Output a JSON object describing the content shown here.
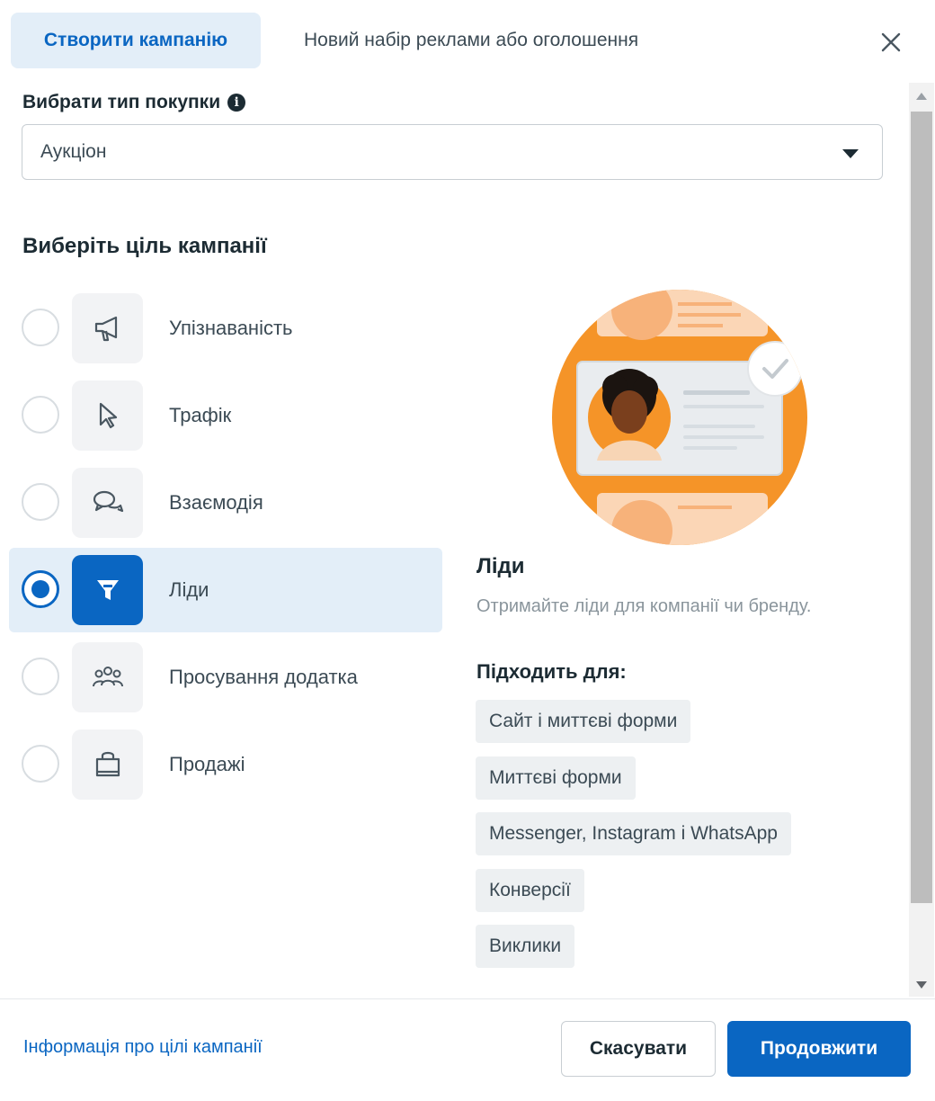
{
  "header": {
    "tab_create": "Створити кампанію",
    "tab_new": "Новий набір реклами або оголошення",
    "close_icon": "close-icon"
  },
  "purchase": {
    "label": "Вибрати тип покупки",
    "info_icon": "info-icon",
    "selected": "Аукціон"
  },
  "goal_title": "Виберіть ціль кампанії",
  "objectives": [
    {
      "label": "Упізнаваність",
      "icon": "megaphone-icon",
      "selected": false
    },
    {
      "label": "Трафік",
      "icon": "cursor-icon",
      "selected": false
    },
    {
      "label": "Взаємодія",
      "icon": "chat-bubbles-icon",
      "selected": false
    },
    {
      "label": "Ліди",
      "icon": "funnel-icon",
      "selected": true
    },
    {
      "label": "Просування додатка",
      "icon": "people-icon",
      "selected": false
    },
    {
      "label": "Продажі",
      "icon": "shopping-bag-icon",
      "selected": false
    }
  ],
  "detail": {
    "title": "Ліди",
    "description": "Отримайте ліди для компанії чи бренду.",
    "fits_label": "Підходить для:",
    "chips": [
      "Сайт і миттєві форми",
      "Миттєві форми",
      "Messenger, Instagram і WhatsApp",
      "Конверсії",
      "Виклики"
    ]
  },
  "footer": {
    "info_link": "Інформація про цілі кампанії",
    "cancel": "Скасувати",
    "continue": "Продовжити"
  },
  "colors": {
    "accent": "#0a66c2",
    "selected_bg": "#e3eef8",
    "illustration_orange": "#f59428"
  }
}
